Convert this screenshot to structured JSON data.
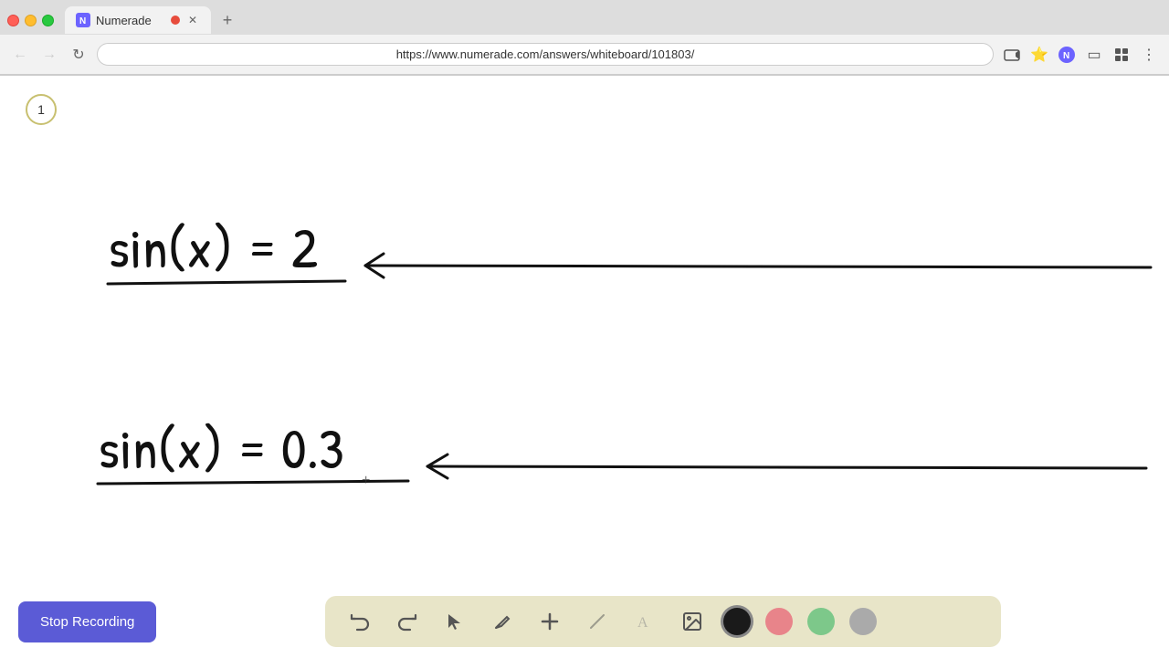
{
  "browser": {
    "tab_label": "Numerade",
    "url": "https://www.numerade.com/answers/whiteboard/101803/",
    "new_tab_label": "+",
    "page_number": "1"
  },
  "toolbar": {
    "stop_recording_label": "Stop Recording",
    "tools": [
      {
        "name": "undo",
        "icon": "↺",
        "label": "Undo"
      },
      {
        "name": "redo",
        "icon": "↻",
        "label": "Redo"
      },
      {
        "name": "select",
        "icon": "▲",
        "label": "Select"
      },
      {
        "name": "pen",
        "icon": "✏",
        "label": "Pen"
      },
      {
        "name": "add",
        "icon": "+",
        "label": "Add"
      },
      {
        "name": "eraser",
        "icon": "/",
        "label": "Eraser"
      },
      {
        "name": "text",
        "icon": "A",
        "label": "Text"
      },
      {
        "name": "image",
        "icon": "🖼",
        "label": "Image"
      }
    ],
    "colors": [
      {
        "name": "black",
        "hex": "#1a1a1a"
      },
      {
        "name": "pink",
        "hex": "#e8848a"
      },
      {
        "name": "green",
        "hex": "#7dc88a"
      },
      {
        "name": "gray",
        "hex": "#aaaaaa"
      }
    ]
  },
  "whiteboard": {
    "equation1": "sin(x) = 2 →",
    "equation2": "sin(x) = 0.3 →"
  }
}
